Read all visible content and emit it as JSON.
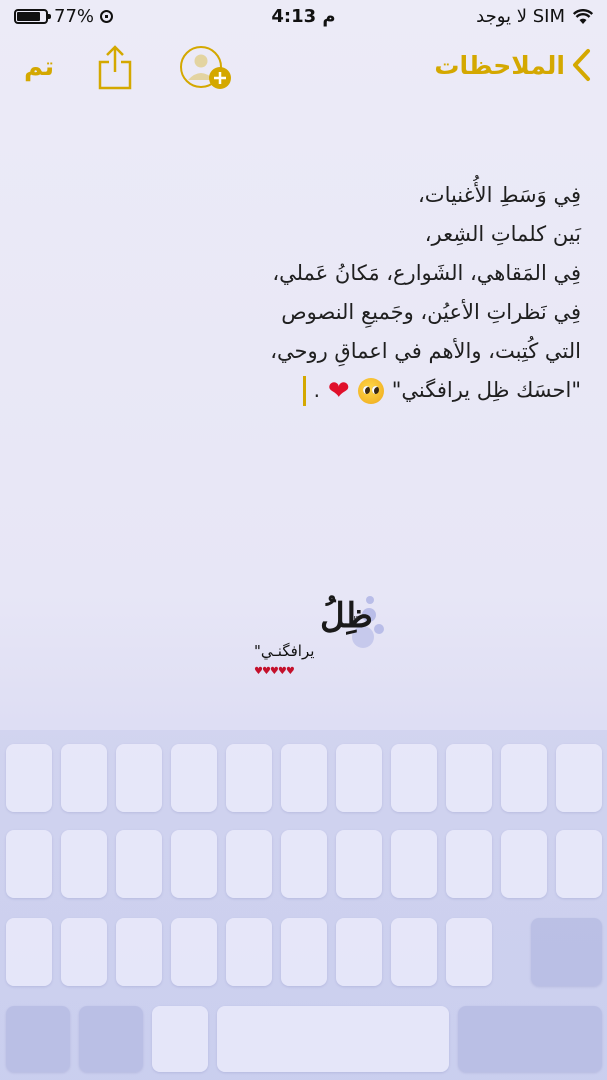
{
  "status_bar": {
    "battery_percent": "77%",
    "battery_level": 0.77,
    "time": "4:13 م",
    "carrier": "لا يوجد SIM",
    "icons": [
      "battery-icon",
      "rotation-lock-icon",
      "wifi-icon"
    ]
  },
  "nav": {
    "done_label": "تم",
    "back_label": "الملاحظات",
    "icons": [
      "share-icon",
      "add-contact-icon",
      "chevron-left-icon"
    ],
    "accent_color": "#d4a800"
  },
  "note": {
    "lines": [
      "فِي وَسَطِ الأُغنيات،",
      "بَين كلماتِ الشِعر،",
      "فِي المَقاهي، الشَوارع، مَكانُ عَملي،",
      "فِي نَظراتِ الأعيُن، وجَميعِ النصوص",
      "التي كُتِبت، والأهم في اعماقِ روحي،",
      "\"احسَك ظِل يرافگني\""
    ],
    "trailing_dot": "."
  },
  "watermark": {
    "title": "ظِلُ",
    "quote_mark": "\"",
    "subtitle": "يرافگنـي\"",
    "hearts": "♥♥♥♥♥"
  }
}
